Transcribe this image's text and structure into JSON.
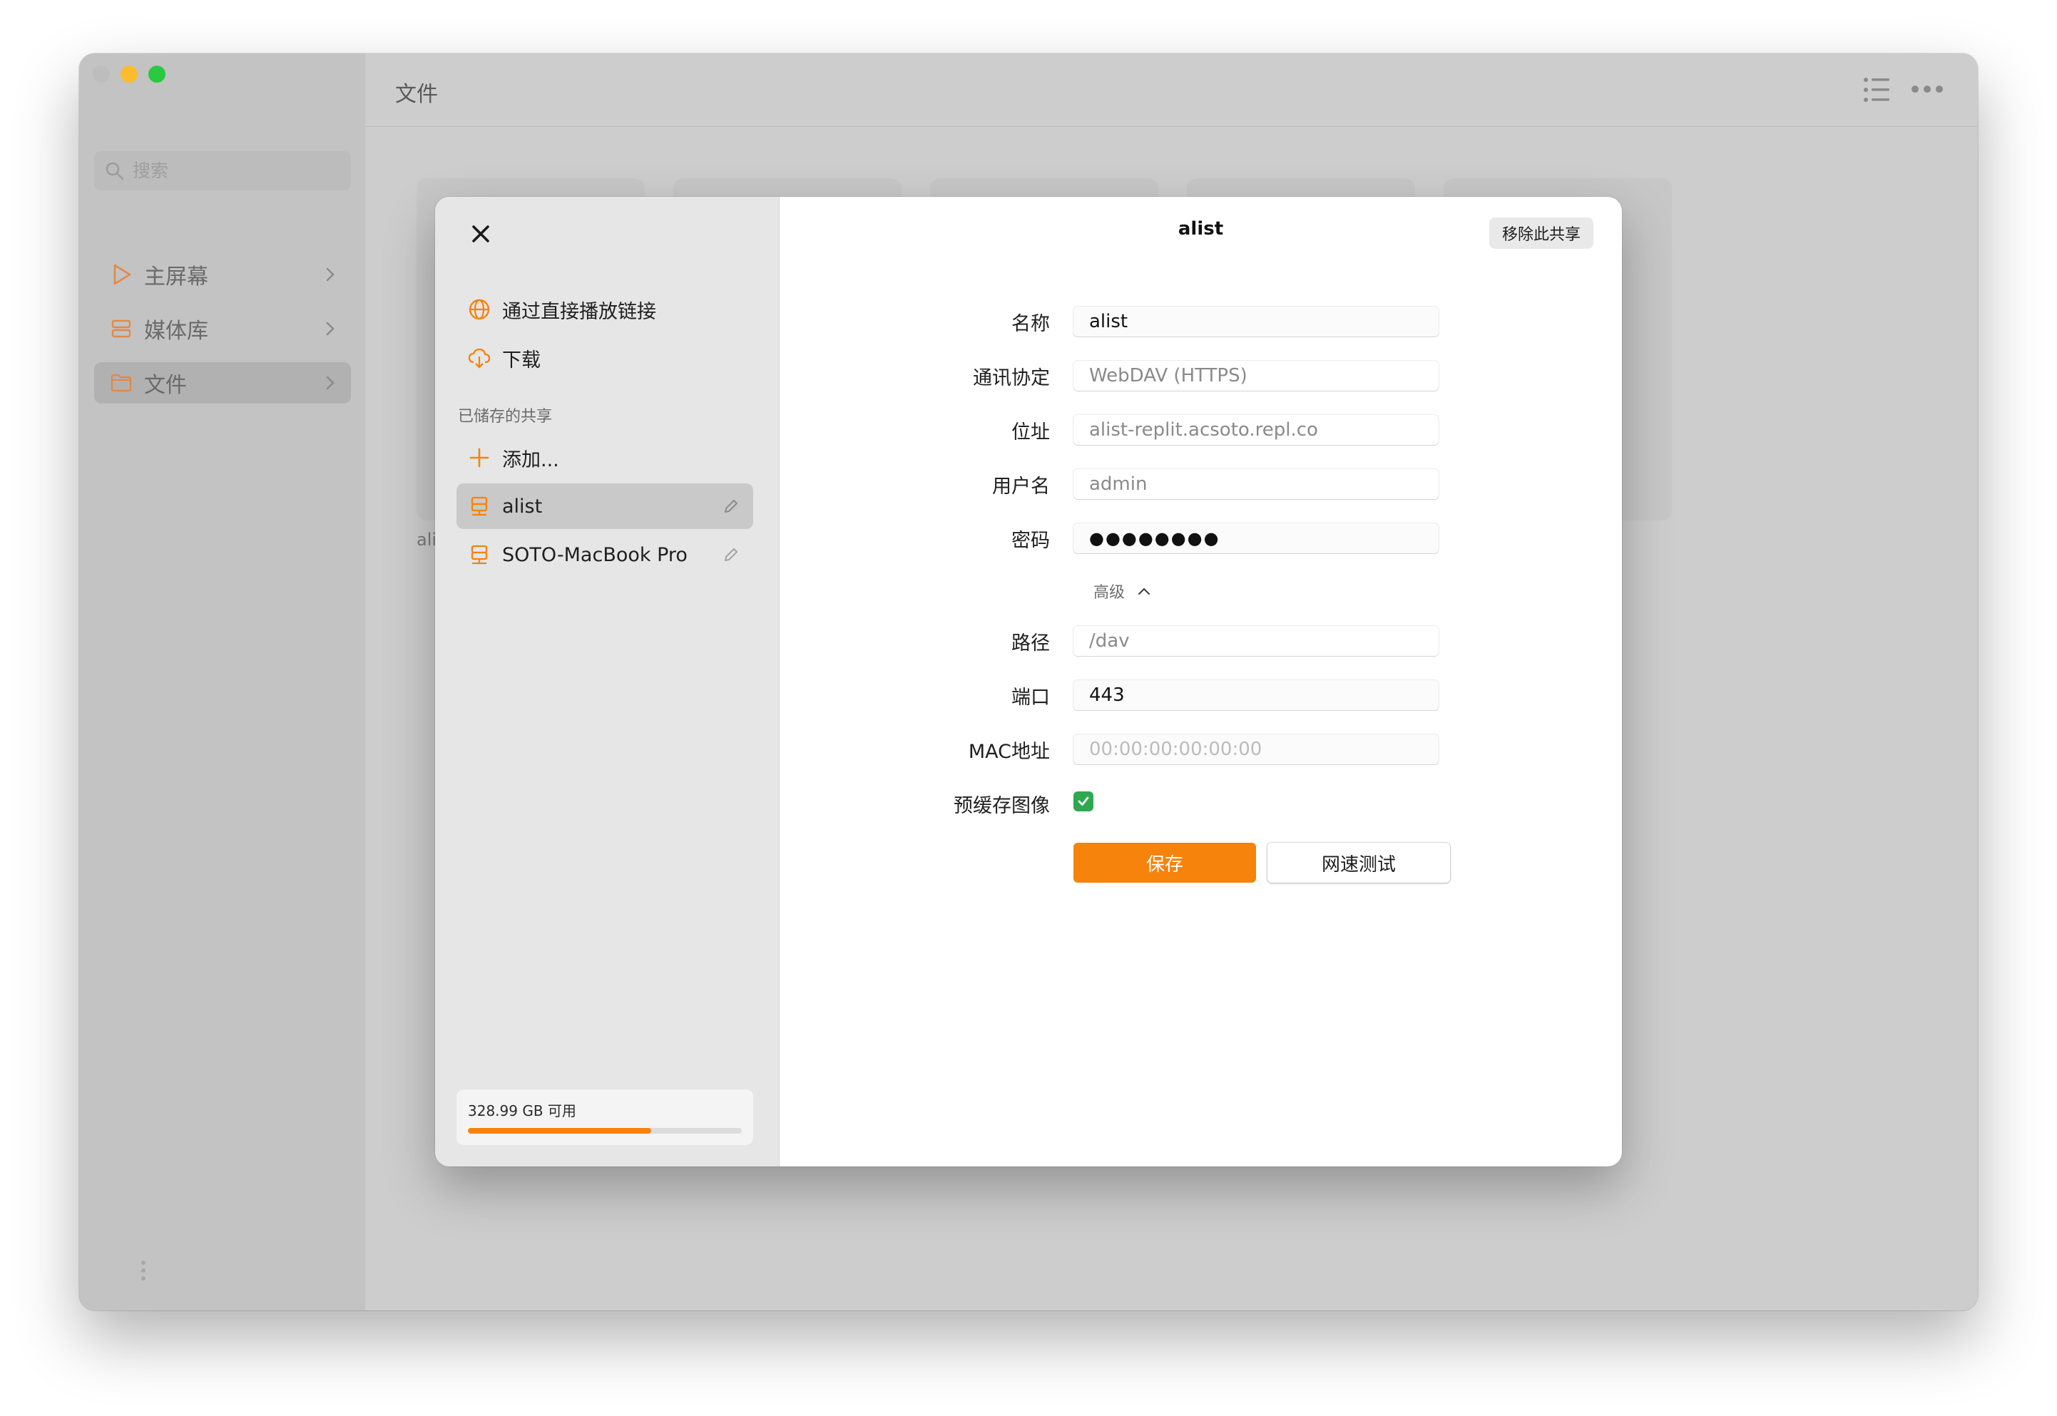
{
  "app": {
    "header_title": "文件",
    "search": {
      "placeholder": "搜索"
    },
    "sidebar": {
      "items": [
        {
          "label": "主屏幕",
          "icon": "play-icon"
        },
        {
          "label": "媒体库",
          "icon": "library-icon"
        },
        {
          "label": "文件",
          "icon": "folder-icon"
        }
      ],
      "active_item": "文件"
    },
    "background_label": "ali"
  },
  "dialog": {
    "title": "alist",
    "remove_button": "移除此共享",
    "side": {
      "actions": [
        {
          "label": "通过直接播放链接",
          "icon": "globe-icon"
        },
        {
          "label": "下载",
          "icon": "cloud-download-icon"
        }
      ],
      "section_title": "已储存的共享",
      "add_label": "添加...",
      "shares": [
        {
          "label": "alist",
          "selected": true
        },
        {
          "label": "SOTO-MacBook Pro",
          "selected": false
        }
      ],
      "storage": {
        "text": "328.99 GB 可用",
        "used_fraction": 0.67
      }
    },
    "form": {
      "name": {
        "label": "名称",
        "value": "alist"
      },
      "protocol": {
        "label": "通讯协定",
        "value": "WebDAV (HTTPS)"
      },
      "address": {
        "label": "位址",
        "value": "alist-replit.acsoto.repl.co"
      },
      "username": {
        "label": "用户名",
        "value": "admin"
      },
      "password": {
        "label": "密码",
        "value": "●●●●●●●●"
      },
      "advanced_label": "高级",
      "path": {
        "label": "路径",
        "value": "/dav"
      },
      "port": {
        "label": "端口",
        "value": "443"
      },
      "mac": {
        "label": "MAC地址",
        "placeholder": "00:00:00:00:00:00"
      },
      "precache": {
        "label": "预缓存图像",
        "checked": true
      },
      "save_button": "保存",
      "speed_test_button": "网速测试"
    }
  },
  "colors": {
    "accent": "#f5830c",
    "check": "#2fa84f"
  }
}
